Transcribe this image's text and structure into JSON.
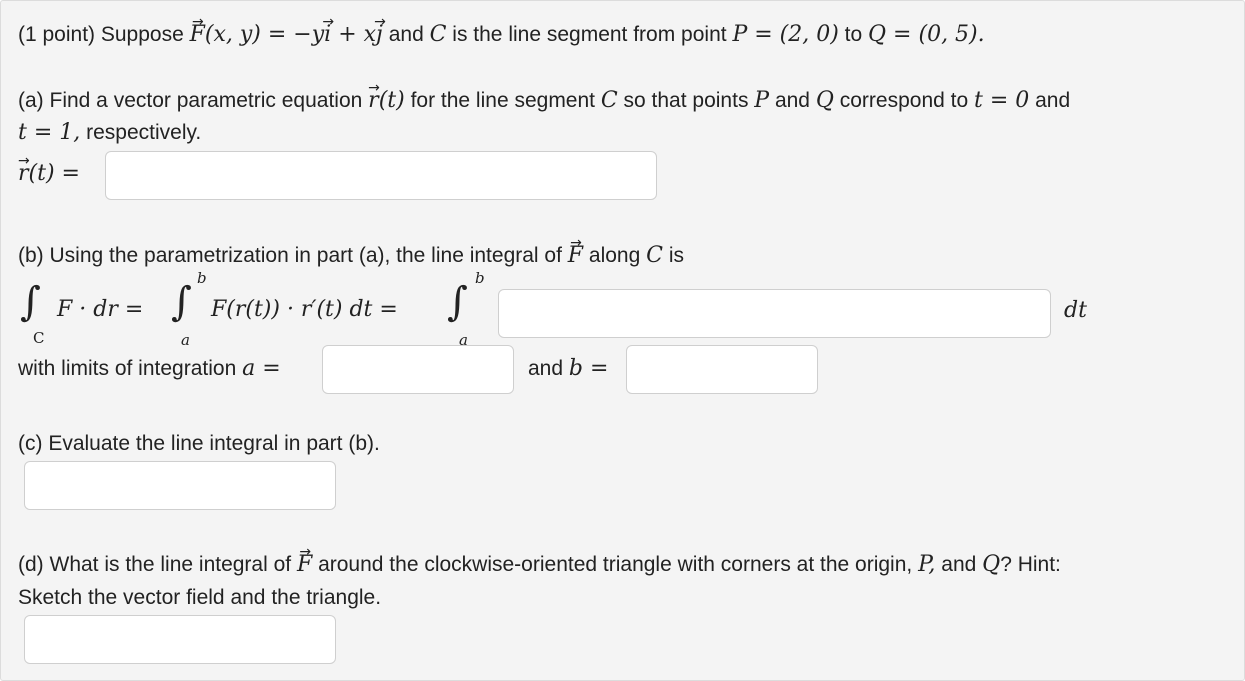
{
  "intro": {
    "prefix": "(1 point) Suppose",
    "F": "F",
    "F_args": "(x, y) = −y",
    "i": "i",
    "plus": " + x",
    "j": "j",
    "mid": "and",
    "C": "C",
    "mid2": "is the line segment from point",
    "P_eq": "P = (2, 0)",
    "to": "to",
    "Q_eq": "Q = (0, 5)."
  },
  "part_a": {
    "line1_a": "(a) Find a vector parametric equation",
    "r": "r",
    "r_arg": "(t)",
    "line1_b": "for the line segment",
    "C": "C",
    "line1_c": "so that points",
    "P": "P",
    "and": "and",
    "Q": "Q",
    "line1_d": "correspond to",
    "t0": "t = 0",
    "and2": "and",
    "t1": "t = 1,",
    "respectively": "respectively.",
    "label_r": "r",
    "label_rt": "(t) ="
  },
  "part_b": {
    "line_a": "(b) Using the parametrization in part (a), the line integral of",
    "F": "F",
    "along": "along",
    "C": "C",
    "is": "is",
    "int_C_sub": "C",
    "lhs": "F · dr =",
    "upper": "b",
    "lower": "a",
    "mid_expr": "F(r(t)) · r′(t) dt =",
    "dt": "dt",
    "limits_label": "with limits of integration",
    "a_eq": "a =",
    "and_b": "and",
    "b_eq": "b ="
  },
  "part_c": {
    "label": "(c) Evaluate the line integral in part (b)."
  },
  "part_d": {
    "line_a": "(d) What is the line integral of",
    "F": "F",
    "line_b": "around the clockwise-oriented triangle with corners at the origin,",
    "P": "P,",
    "and": "and",
    "Q": "Q",
    "hint": "? Hint:",
    "line2": "Sketch the vector field and the triangle."
  },
  "inputs": {
    "r_t": "",
    "integrand": "",
    "a": "",
    "b": "",
    "c": "",
    "d": ""
  }
}
